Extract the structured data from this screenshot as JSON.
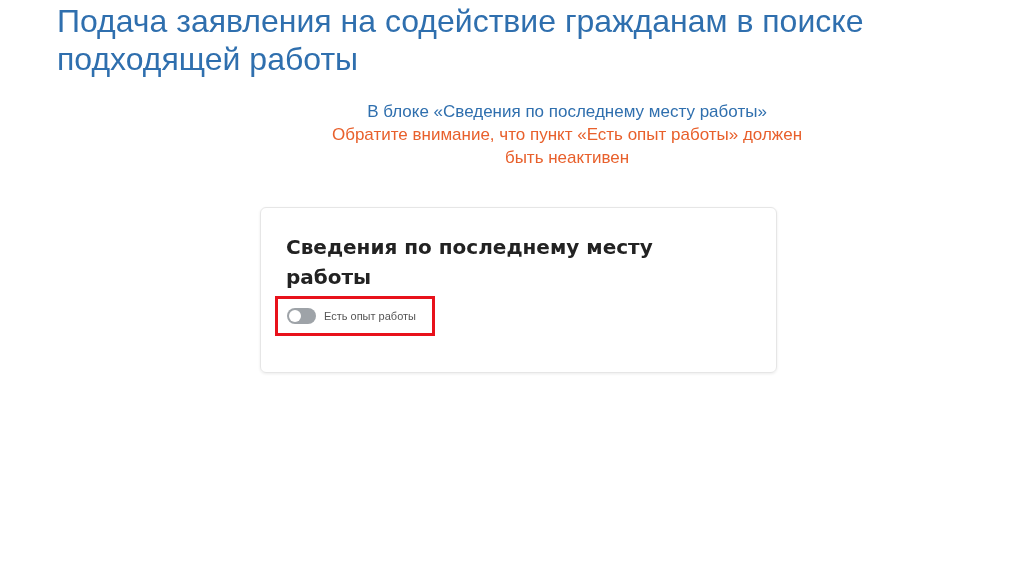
{
  "slide_title": "Подача заявления на содействие гражданам в поиске подходящей работы",
  "notes": [
    {
      "kind": "info",
      "text": "В блоке «Сведения по последнему месту работы»"
    },
    {
      "kind": "warning",
      "text": "Обратите внимание, что пункт «Есть опыт работы» должен быть неактивен"
    }
  ],
  "card": {
    "title": "Сведения по последнему месту работы",
    "highlighted": true,
    "toggle": {
      "label": "Есть опыт работы",
      "on": false
    }
  }
}
